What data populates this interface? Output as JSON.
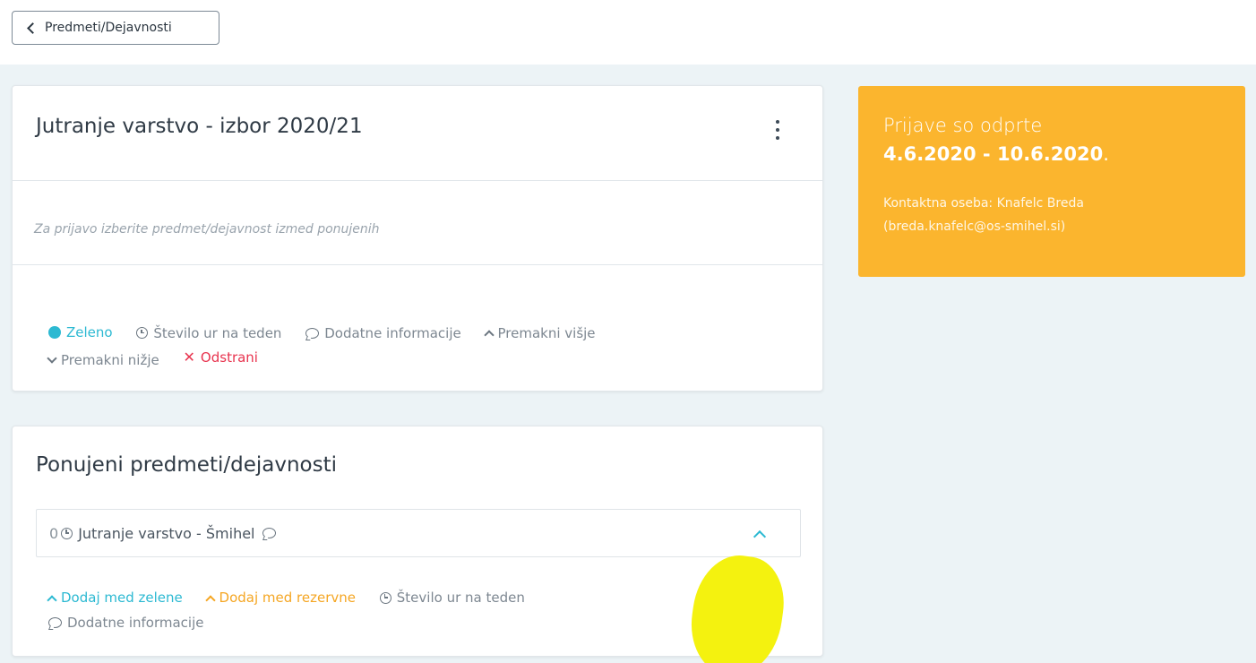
{
  "header": {
    "back_label": "Predmeti/Dejavnosti"
  },
  "selected_card": {
    "title": "Jutranje varstvo - izbor 2020/21",
    "hint": "Za prijavo izberite predmet/dejavnost izmed ponujenih",
    "legend": {
      "green": "Zeleno",
      "hours": "Število ur na teden",
      "info": "Dodatne informacije",
      "move_up": "Premakni višje",
      "move_down": "Premakni nižje",
      "remove": "Odstrani"
    }
  },
  "offered_card": {
    "title": "Ponujeni predmeti/dejavnosti",
    "item": {
      "count": "0",
      "name": "Jutranje varstvo - Šmihel"
    },
    "legend": {
      "add_green": "Dodaj med zelene",
      "add_reserve": "Dodaj med rezervne",
      "hours": "Število ur na teden",
      "info": "Dodatne informacije"
    }
  },
  "info_panel": {
    "heading": "Prijave so odprte",
    "dates": "4.6.2020 - 10.6.2020",
    "dates_suffix": ".",
    "contact_label": "Kontaktna oseba: Knafelc Breda",
    "contact_email": "(breda.knafelc@os-smihel.si)"
  },
  "colors": {
    "accent": "#2cb9d2",
    "danger": "#e8344f",
    "reserve": "#f5a623",
    "panel": "#fbb52e",
    "highlight": "#f4f20f"
  },
  "icons": [
    "back-chevron-icon",
    "kebab-menu-icon",
    "dot-icon",
    "clock-icon",
    "comment-icon",
    "chevron-up-icon",
    "chevron-down-icon",
    "close-icon"
  ]
}
